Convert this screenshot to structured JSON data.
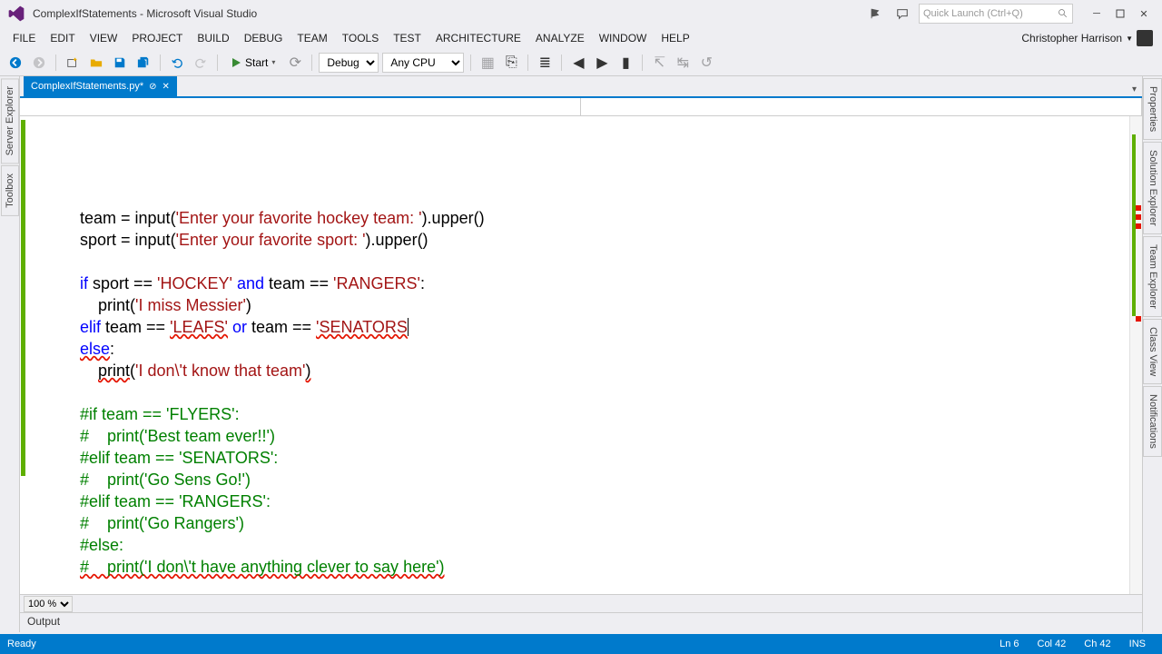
{
  "window": {
    "title": "ComplexIfStatements - Microsoft Visual Studio",
    "quick_launch_placeholder": "Quick Launch (Ctrl+Q)"
  },
  "menu": {
    "items": [
      "FILE",
      "EDIT",
      "VIEW",
      "PROJECT",
      "BUILD",
      "DEBUG",
      "TEAM",
      "TOOLS",
      "TEST",
      "ARCHITECTURE",
      "ANALYZE",
      "WINDOW",
      "HELP"
    ],
    "user": "Christopher Harrison"
  },
  "toolbar": {
    "start_label": "Start",
    "config": "Debug",
    "platform": "Any CPU"
  },
  "left_panels": [
    "Server Explorer",
    "Toolbox"
  ],
  "right_panels": [
    "Properties",
    "Solution Explorer",
    "Team Explorer",
    "Class View",
    "Notifications"
  ],
  "tab": {
    "name": "ComplexIfStatements.py*",
    "modified": true
  },
  "code": {
    "lines": [
      {
        "t": "code",
        "segs": [
          {
            "c": "",
            "x": "team = input("
          },
          {
            "c": "str",
            "x": "'Enter your favorite hockey team: '"
          },
          {
            "c": "",
            "x": ").upper()"
          }
        ]
      },
      {
        "t": "code",
        "segs": [
          {
            "c": "",
            "x": "sport = input("
          },
          {
            "c": "str",
            "x": "'Enter your favorite sport: '"
          },
          {
            "c": "",
            "x": ").upper()"
          }
        ]
      },
      {
        "t": "blank"
      },
      {
        "t": "code",
        "segs": [
          {
            "c": "kw",
            "x": "if"
          },
          {
            "c": "",
            "x": " sport == "
          },
          {
            "c": "str",
            "x": "'HOCKEY'"
          },
          {
            "c": "",
            "x": " "
          },
          {
            "c": "kw",
            "x": "and"
          },
          {
            "c": "",
            "x": " team == "
          },
          {
            "c": "str",
            "x": "'RANGERS'"
          },
          {
            "c": "",
            "x": ":"
          }
        ]
      },
      {
        "t": "code",
        "indent": 1,
        "segs": [
          {
            "c": "",
            "x": "print("
          },
          {
            "c": "str",
            "x": "'I miss Messier'"
          },
          {
            "c": "",
            "x": ")"
          }
        ]
      },
      {
        "t": "code",
        "err": true,
        "cursor": true,
        "segs": [
          {
            "c": "kw",
            "x": "elif"
          },
          {
            "c": "",
            "x": " team == "
          },
          {
            "c": "str und",
            "x": "'LEAFS'"
          },
          {
            "c": "",
            "x": " "
          },
          {
            "c": "kw",
            "x": "or"
          },
          {
            "c": "",
            "x": " team == "
          },
          {
            "c": "str und",
            "x": "'SENATORS"
          }
        ]
      },
      {
        "t": "code",
        "segs": [
          {
            "c": "kw und",
            "x": "else"
          },
          {
            "c": "",
            "x": ":"
          }
        ]
      },
      {
        "t": "code",
        "indent": 1,
        "segs": [
          {
            "c": "und",
            "x": "print"
          },
          {
            "c": "",
            "x": "("
          },
          {
            "c": "str",
            "x": "'I don\\'t know that team'"
          },
          {
            "c": "und",
            "x": ")"
          }
        ]
      },
      {
        "t": "blank"
      },
      {
        "t": "comment",
        "x": "#if team == 'FLYERS':"
      },
      {
        "t": "comment",
        "x": "#    print('Best team ever!!')"
      },
      {
        "t": "comment",
        "x": "#elif team == 'SENATORS':"
      },
      {
        "t": "comment",
        "x": "#    print('Go Sens Go!')"
      },
      {
        "t": "comment",
        "x": "#elif team == 'RANGERS':"
      },
      {
        "t": "comment",
        "x": "#    print('Go Rangers')"
      },
      {
        "t": "comment",
        "x": "#else:"
      },
      {
        "t": "comment",
        "und": true,
        "x": "#    print('I don\\'t have anything clever to say here')"
      }
    ]
  },
  "zoom": "100 %",
  "output_label": "Output",
  "status": {
    "ready": "Ready",
    "line": "Ln 6",
    "col": "Col 42",
    "ch": "Ch 42",
    "ins": "INS"
  }
}
